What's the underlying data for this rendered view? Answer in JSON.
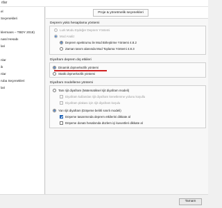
{
  "window": {
    "title": "ıtlar"
  },
  "sidebar": {
    "items": [
      {
        "label": "el"
      },
      {
        "label": "Seçenekleri"
      },
      {
        "label": ""
      },
      {
        "label": "klermans – TBDY 2018)"
      },
      {
        "label": "nasıl Hesabı"
      },
      {
        "label": "lari"
      },
      {
        "label": ""
      },
      {
        "label": "nlar"
      },
      {
        "label": "ik"
      },
      {
        "label": "nlar"
      },
      {
        "label": "ruba Seçenekleri"
      },
      {
        "label": "lari"
      }
    ]
  },
  "main": {
    "tab_label": "Proje & yönetmelik seçenekleri",
    "group1": {
      "title": "Deprem yükü hesaplama yöntemi",
      "options": [
        {
          "label": "Lurk Modu Eşdeğer Deprem Yöntemi"
        },
        {
          "label": "Mod Analiz"
        },
        {
          "label": "Deprem spektrumu ile Mod Birleştirme Yöntemi 4.8.2"
        },
        {
          "label": "Zaman tanım alanında Mod Toplama Yöntemi 4.8.3"
        }
      ]
    },
    "group2": {
      "title": "Diyafram deprem dış etkileri",
      "options": [
        {
          "label": "Dinamik dışmerkezlik yöntemi"
        },
        {
          "label": "Statik dışmerkezlik yöntemi"
        }
      ]
    },
    "group3": {
      "title": "Diyafram modelleme yöntemi",
      "options": [
        {
          "label": "Tam rijit diyafram (Matematiksel rijit diyafram modeli)"
        },
        {
          "label": "Diyafram kullanılan rijit diyafram kenetlenme yolunu koşullu"
        },
        {
          "label": "Diyafram plakası için rijit diyafram koşulu"
        },
        {
          "label": "Yarı rijit diyafram (Döşeme belirli sınırlı modeli)"
        },
        {
          "label": "Döşeme tasarımında deprem etkilerini dikkate al"
        },
        {
          "label": "Döşeme donatı hesabında düzlem içi kuvvetleri dikkate al"
        }
      ]
    }
  },
  "footer": {
    "ok_label": "Tamam"
  },
  "colors": {
    "accent": "#1a5fb4",
    "highlight_underline": "#d12020"
  }
}
